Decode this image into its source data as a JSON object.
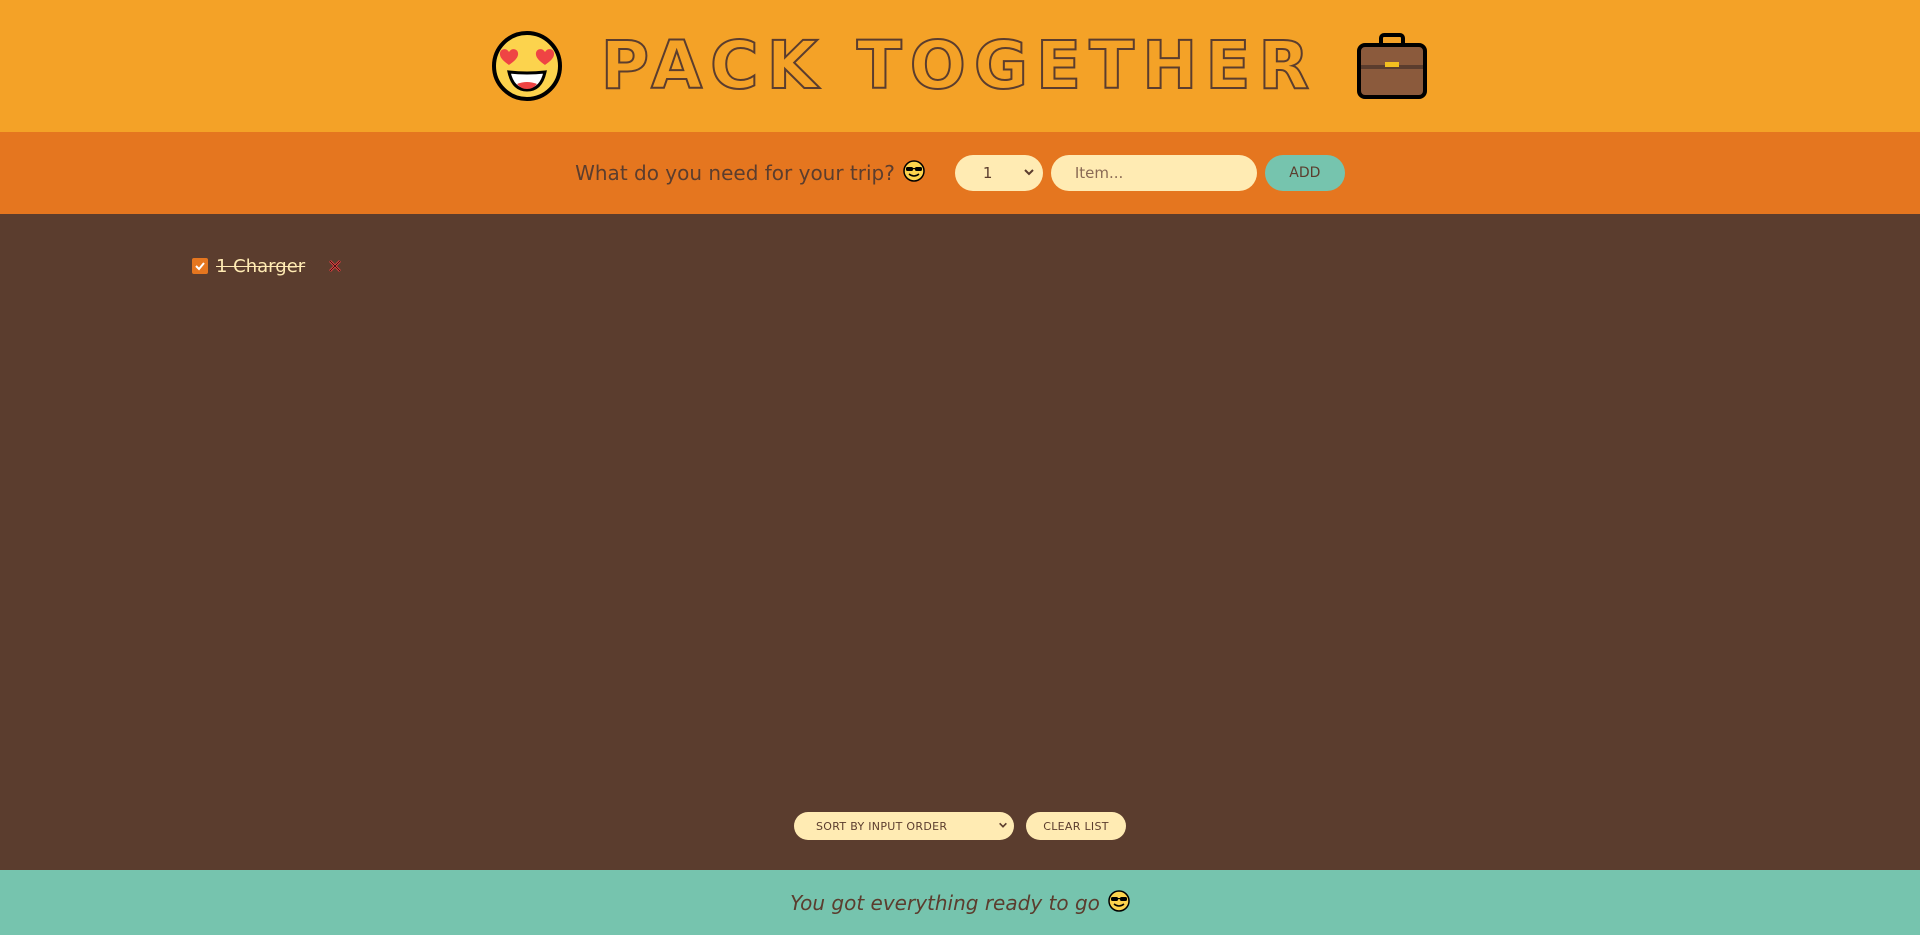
{
  "header": {
    "title": "PACK TOGETHER",
    "left_icon": "heart-eyes-face-icon",
    "right_icon": "briefcase-icon"
  },
  "form": {
    "question": "What do you need for your trip?",
    "question_icon": "sunglasses-face-icon",
    "quantity_selected": "1",
    "item_placeholder": "Item...",
    "add_label": "ADD"
  },
  "list": {
    "items": [
      {
        "text": "1 Charger",
        "packed": true
      }
    ]
  },
  "actions": {
    "sort_selected": "SORT BY INPUT ORDER",
    "clear_label": "CLEAR LIST"
  },
  "footer": {
    "text": "You got everything ready to go",
    "icon": "sunglasses-face-icon"
  },
  "colors": {
    "header_bg": "#f4a227",
    "form_bg": "#e5761f",
    "main_bg": "#5b3d2e",
    "footer_bg": "#76c4ae",
    "cream": "#ffebb3"
  }
}
